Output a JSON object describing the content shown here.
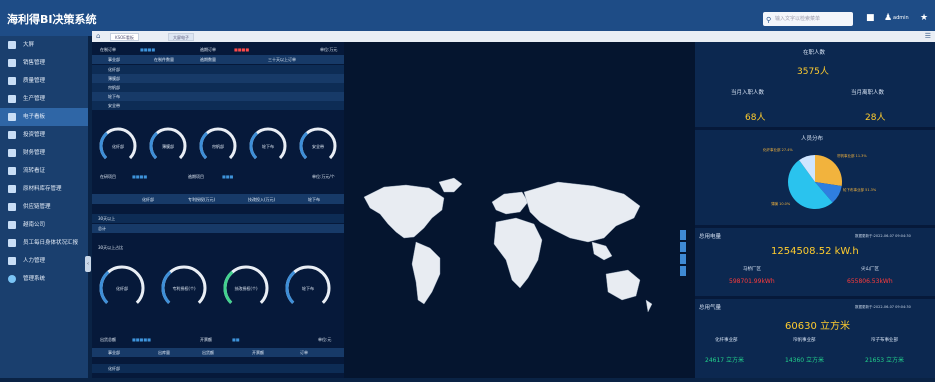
{
  "app": {
    "title": "海利得BI决策系统"
  },
  "header": {
    "search_placeholder": "输入文字以检索菜单",
    "user": "admin"
  },
  "sidebar": {
    "items": [
      {
        "label": "大屏"
      },
      {
        "label": "销售管理"
      },
      {
        "label": "质量管理"
      },
      {
        "label": "生产管理"
      },
      {
        "label": "电子看板"
      },
      {
        "label": "投资管理"
      },
      {
        "label": "财务管理"
      },
      {
        "label": "流转看证"
      },
      {
        "label": "原材料库存管理"
      },
      {
        "label": "供应链管理"
      },
      {
        "label": "越南公司"
      },
      {
        "label": "员工每日身体状况汇报"
      },
      {
        "label": "人力管理"
      },
      {
        "label": "管理系统"
      }
    ]
  },
  "tabs": [
    {
      "label": "KSOE看板"
    },
    {
      "label": "大屏电子"
    }
  ],
  "left": {
    "s1": {
      "title": "在制订单",
      "title2": "逾期订单",
      "unit": "单位:万元",
      "headers": [
        "事业部",
        "在制件数量",
        "逾期数量",
        "三十天以上订单"
      ],
      "rows": [
        "化纤部",
        "薄膜部",
        "帘帆部",
        "轮下布",
        "安全带"
      ],
      "gauges": [
        "化纤部",
        "薄膜部",
        "帘帆部",
        "轮下布",
        "安全带"
      ]
    },
    "s2": {
      "title": "在研项目",
      "title2": "逾期项目",
      "unit": "单位:万元/个",
      "headers": [
        "化纤部",
        "专利授权(万元)",
        "技改投入(万元)",
        "轮下布"
      ],
      "rows": [
        "30天以上",
        "总计"
      ],
      "sub": "30天以上占比",
      "gauges": [
        "化纤部",
        "专利授权(个)",
        "技改授权(个)",
        "轮下布"
      ]
    },
    "s3": {
      "title": "出货总额",
      "title2": "开票额",
      "unit": "单位:元",
      "headers": [
        "事业部",
        "出库量",
        "出货额",
        "开票额",
        "订单"
      ],
      "rows": [
        "化纤部"
      ]
    }
  },
  "right": {
    "emp": {
      "label": "在职人数",
      "value": "3575人"
    },
    "join": {
      "label": "当月入职人数",
      "value": "68人"
    },
    "leave": {
      "label": "当月离职人数",
      "value": "28人"
    },
    "dist": {
      "title": "人员分布",
      "slices": [
        {
          "label": "化纤事业部",
          "value": 27.4,
          "color": "#f2b33d"
        },
        {
          "label": "帘帆事业部",
          "value": 11.3,
          "color": "#2f7ee0"
        },
        {
          "label": "轮下布事业部",
          "value": 51.3,
          "color": "#2ac3ee"
        },
        {
          "label": "薄膜",
          "value": 10.0,
          "color": "#cfe5ff"
        }
      ],
      "labels": [
        "化纤事业部\n27.4%",
        "帘帆事业部\n11.3%",
        "轮下布事业部\n51.3%",
        "薄膜\n10.0%"
      ]
    },
    "power": {
      "title": "总用电量",
      "date": "数据更新于:2022-06-07 09:04:30",
      "value": "1254508.52 kW.h",
      "a_label": "马桥厂区",
      "a_value": "598701.99kWh",
      "b_label": "尖山厂区",
      "b_value": "655806.53kWh"
    },
    "gas": {
      "title": "总用气量",
      "date": "数据更新于:2022-06-07 09:04:30",
      "value": "60630 立方米",
      "cols": [
        {
          "label": "化纤事业部",
          "value": "24617 立方米"
        },
        {
          "label": "帘帆事业部",
          "value": "14360 立方米"
        },
        {
          "label": "帘子布事业部",
          "value": "21653 立方米"
        }
      ]
    }
  },
  "colors": {
    "accent": "#1e4c86",
    "yellow": "#ffcc2e",
    "green": "#22d28c",
    "red": "#ff3b3b"
  }
}
